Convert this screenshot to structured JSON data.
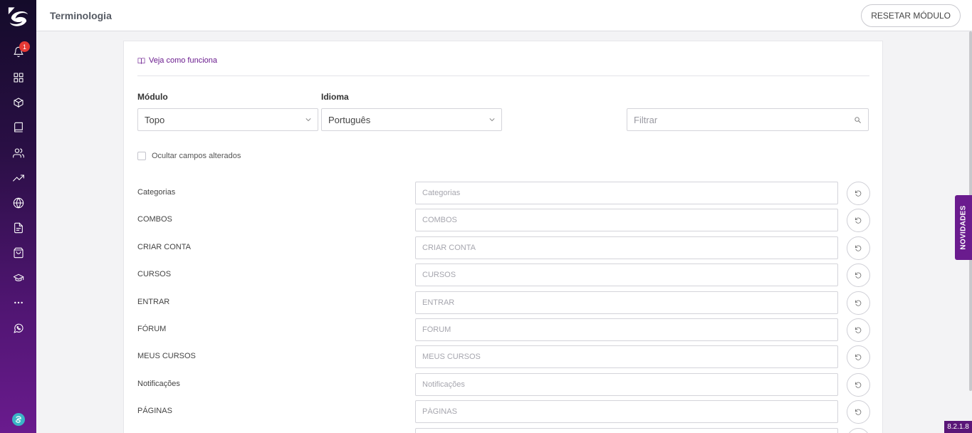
{
  "header": {
    "title": "Terminologia",
    "reset_label": "RESETAR MÓDULO"
  },
  "sidebar": {
    "notification_count": "1",
    "items": [
      {
        "icon": "bell-icon"
      },
      {
        "icon": "grid-icon"
      },
      {
        "icon": "box-icon"
      },
      {
        "icon": "book-icon"
      },
      {
        "icon": "users-icon"
      },
      {
        "icon": "trending-up-icon"
      },
      {
        "icon": "globe-icon"
      },
      {
        "icon": "file-icon"
      },
      {
        "icon": "shopping-bag-icon"
      },
      {
        "icon": "graduation-cap-icon"
      },
      {
        "icon": "more-icon"
      },
      {
        "icon": "whatsapp-icon"
      }
    ]
  },
  "card": {
    "help_link": "Veja como funciona",
    "module_label": "Módulo",
    "module_value": "Topo",
    "language_label": "Idioma",
    "language_value": "Português",
    "filter_placeholder": "Filtrar",
    "hide_changed_label": "Ocultar campos alterados"
  },
  "terms": [
    {
      "label": "Categorias",
      "placeholder": "Categorias"
    },
    {
      "label": "COMBOS",
      "placeholder": "COMBOS"
    },
    {
      "label": "CRIAR CONTA",
      "placeholder": "CRIAR CONTA"
    },
    {
      "label": "CURSOS",
      "placeholder": "CURSOS"
    },
    {
      "label": "ENTRAR",
      "placeholder": "ENTRAR"
    },
    {
      "label": "FÓRUM",
      "placeholder": "FÓRUM"
    },
    {
      "label": "MEUS CURSOS",
      "placeholder": "MEUS CURSOS"
    },
    {
      "label": "Notificações",
      "placeholder": "Notificações"
    },
    {
      "label": "PÁGINAS",
      "placeholder": "PÁGINAS"
    }
  ],
  "novidades_label": "NOVIDADES",
  "version": "8.2.1.8",
  "colors": {
    "brand": "#6a1b8e",
    "sidebar_top": "#140b2a",
    "badge": "#e53935"
  }
}
